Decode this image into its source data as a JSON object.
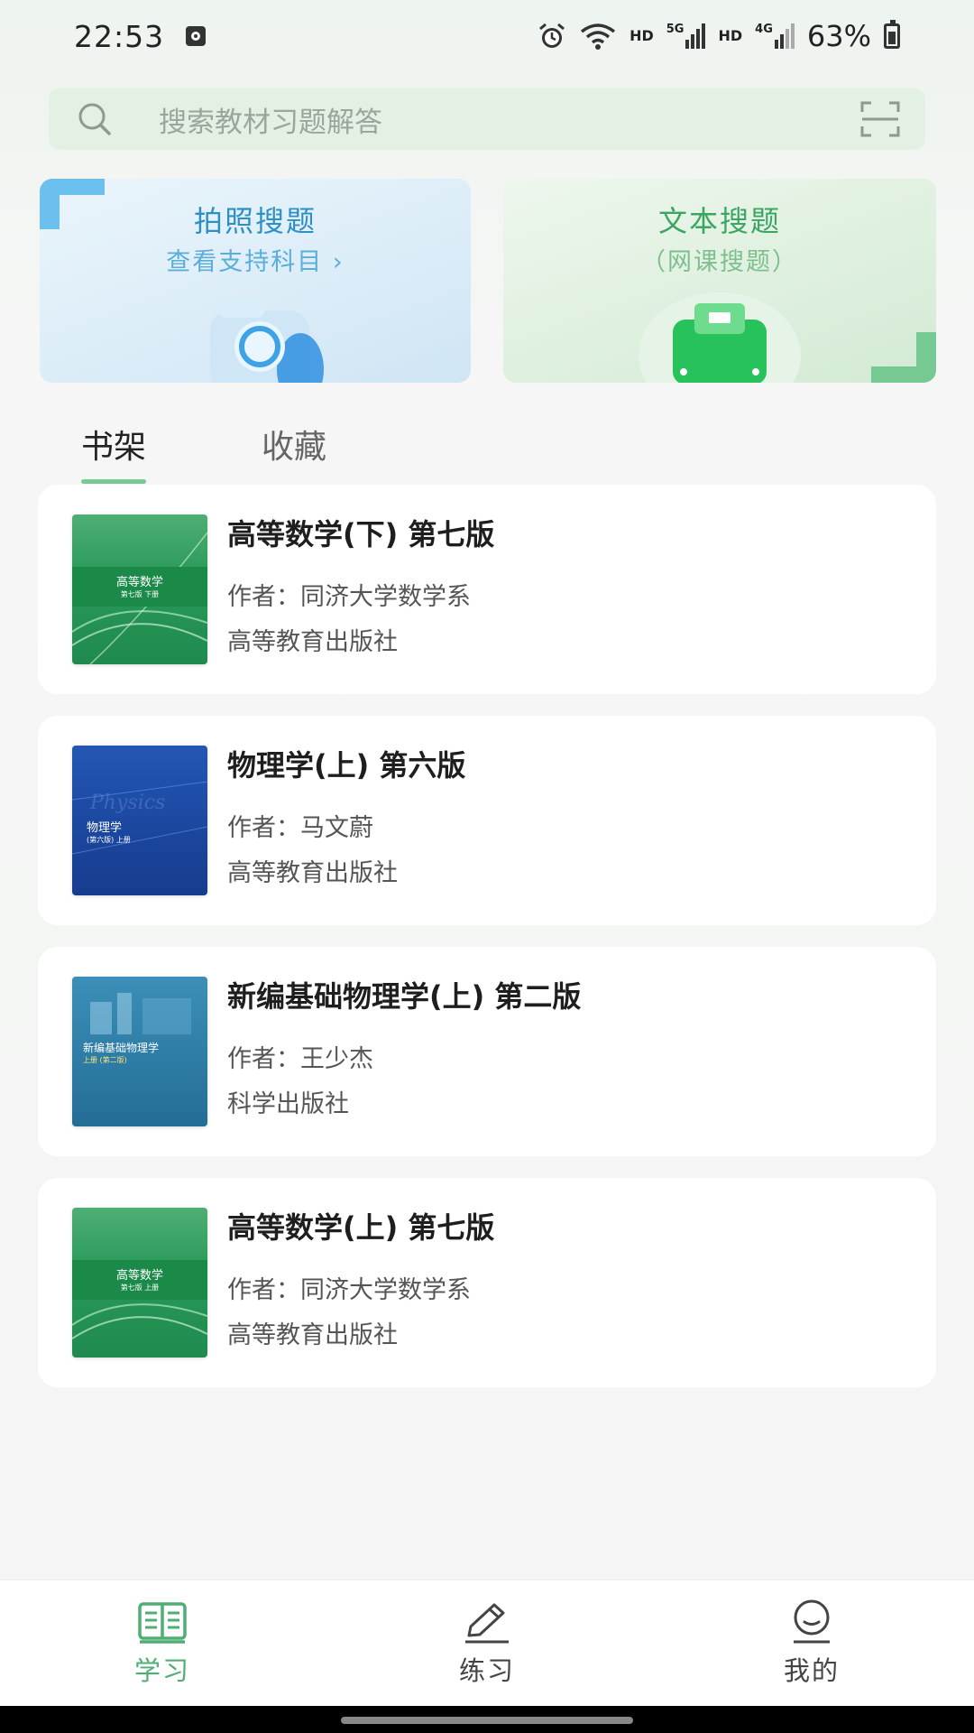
{
  "status_bar": {
    "time": "22:53",
    "hd1": "HD",
    "net1": "5G",
    "hd2": "HD",
    "net2": "4G",
    "battery": "63%"
  },
  "search": {
    "placeholder": "搜索教材习题解答"
  },
  "cards": {
    "photo": {
      "title": "拍照搜题",
      "subtitle": "查看支持科目 ›"
    },
    "text": {
      "title": "文本搜题",
      "subtitle": "（网课搜题）"
    }
  },
  "tabs": [
    {
      "label": "书架",
      "active": true
    },
    {
      "label": "收藏",
      "active": false
    }
  ],
  "books": [
    {
      "title": "高等数学(下) 第七版",
      "author": "作者：同济大学数学系",
      "publisher": "高等教育出版社",
      "cover_title": "高等数学",
      "cover_sub": "第七版 下册"
    },
    {
      "title": "物理学(上) 第六版",
      "author": "作者：马文蔚",
      "publisher": "高等教育出版社",
      "cover_title": "物理学",
      "cover_sub": "(第六版) 上册"
    },
    {
      "title": "新编基础物理学(上) 第二版",
      "author": "作者：王少杰",
      "publisher": "科学出版社",
      "cover_title": "新编基础物理学",
      "cover_sub": "上册 (第二版)"
    },
    {
      "title": "高等数学(上) 第七版",
      "author": "作者：同济大学数学系",
      "publisher": "高等教育出版社",
      "cover_title": "高等数学",
      "cover_sub": "第七版 上册"
    }
  ],
  "bottom_nav": [
    {
      "label": "学习",
      "icon": "book-icon",
      "active": true
    },
    {
      "label": "练习",
      "icon": "pencil-icon",
      "active": false
    },
    {
      "label": "我的",
      "icon": "profile-icon",
      "active": false
    }
  ],
  "colors": {
    "accent_green": "#4fae74",
    "photo_blue": "#2e8fc4",
    "text_green": "#3aa661"
  }
}
